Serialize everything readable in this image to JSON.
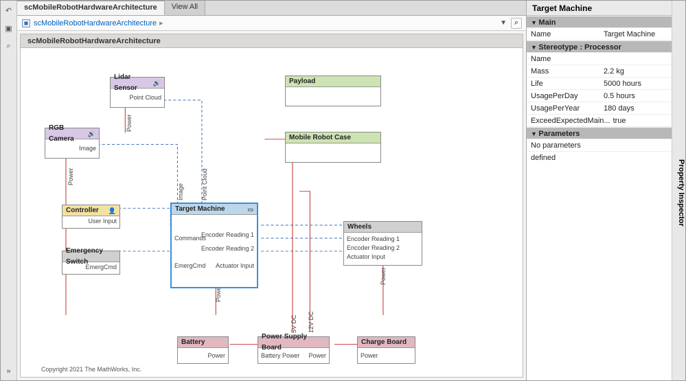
{
  "tabs": {
    "active": "scMobileRobotHardwareArchitecture",
    "viewAll": "View All"
  },
  "breadcrumb": {
    "root": "scMobileRobotHardwareArchitecture"
  },
  "canvas": {
    "title": "scMobileRobotHardwareArchitecture",
    "copyright": "Copyright 2021 The MathWorks, Inc."
  },
  "blocks": {
    "lidar": {
      "title": "Lidar Sensor",
      "ports": {
        "out1": "Point Cloud"
      }
    },
    "rgb": {
      "title": "RGB Camera",
      "ports": {
        "out1": "Image"
      }
    },
    "controller": {
      "title": "Controller",
      "ports": {
        "out1": "User Input"
      }
    },
    "emergency": {
      "title": "Emergency Switch",
      "ports": {
        "out1": "EmergCmd"
      }
    },
    "payload": {
      "title": "Payload"
    },
    "case": {
      "title": "Mobile Robot Case"
    },
    "target": {
      "title": "Target Machine",
      "ports": {
        "inImage": "Image",
        "inPointCloud": "Point Cloud",
        "inCommands": "Commands",
        "inEmerg": "EmergCmd",
        "outEnc1": "Encoder Reading 1",
        "outEnc2": "Encoder Reading 2",
        "outAct": "Actuator Input"
      }
    },
    "wheels": {
      "title": "Wheels",
      "ports": {
        "inEnc1": "Encoder Reading 1",
        "inEnc2": "Encoder Reading 2",
        "inAct": "Actuator Input"
      }
    },
    "battery": {
      "title": "Battery",
      "ports": {
        "out": "Power"
      }
    },
    "psu": {
      "title": "Power Supply Board",
      "ports": {
        "in": "Battery Power",
        "out": "Power"
      }
    },
    "charge": {
      "title": "Charge Board",
      "ports": {
        "out": "Power"
      }
    }
  },
  "wireLabels": {
    "image": "Image",
    "pointCloud": "Point Cloud",
    "power": "Power",
    "v5": "5V DC",
    "v12": "12V DC"
  },
  "inspector": {
    "title": "Target Machine",
    "tabLabel": "Property Inspector",
    "sections": {
      "main": {
        "header": "Main",
        "rows": [
          {
            "k": "Name",
            "v": "Target Machine"
          }
        ]
      },
      "stereotype": {
        "header": "Stereotype : Processor",
        "rows": [
          {
            "k": "Name",
            "v": ""
          },
          {
            "k": "Mass",
            "v": "2.2 kg"
          },
          {
            "k": "Life",
            "v": "5000 hours"
          },
          {
            "k": "UsagePerDay",
            "v": "0.5 hours"
          },
          {
            "k": "UsagePerYear",
            "v": "180 days"
          },
          {
            "k": "ExceedExpectedMain...",
            "v": "true"
          }
        ]
      },
      "parameters": {
        "header": "Parameters",
        "rows": [
          {
            "k": "No parameters defined",
            "v": ""
          }
        ]
      }
    }
  },
  "chart_data": {
    "type": "table",
    "title": "Target Machine — Stereotype : Processor",
    "categories": [
      "Mass",
      "Life",
      "UsagePerDay",
      "UsagePerYear",
      "ExceedExpectedMaintenance"
    ],
    "values": [
      "2.2 kg",
      "5000 hours",
      "0.5 hours",
      "180 days",
      "true"
    ]
  }
}
